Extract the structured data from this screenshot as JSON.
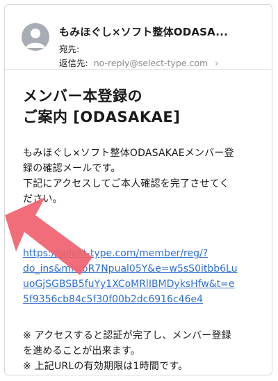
{
  "email": {
    "sender": "もみほぐし×ソフト整体ODASA...",
    "to_label": "宛先:",
    "to_value": "",
    "reply_to_label": "返信先:",
    "reply_to_value": "no-reply@select-type.com",
    "chevron": "›"
  },
  "message": {
    "title_line1": "メンバー本登録の",
    "title_line2": "ご案内 [ODASAKAE]",
    "body_line1": "もみほぐし×ソフト整体ODASAKAEメンバー登",
    "body_line2": "録の確認メールです。",
    "body_line3": "下記にアクセスしてご本人確認を完了させてく",
    "body_line4": "ださい。",
    "link_line1": "https://select-type.com/member/reg/?",
    "link_line2": "do_ins&mi=bR7Npual05Y&e=w5sS0itbb6Lu",
    "link_line3": "uoGjSGBSB5fuYy1XCoMRlIBMDyksHfw&t=e",
    "link_line4": "5f9356cb84c5f30f00b2dc6916c46e4",
    "note_line1": "※ アクセスすると認証が完了し、メンバー登録",
    "note_line2": "を進めることが出来ます。",
    "note_line3": "※ 上記URLの有効期限は1時間です。"
  },
  "colors": {
    "link": "#2f6fd0",
    "arrow": "#f0616e",
    "avatar": "#a8acb4"
  }
}
